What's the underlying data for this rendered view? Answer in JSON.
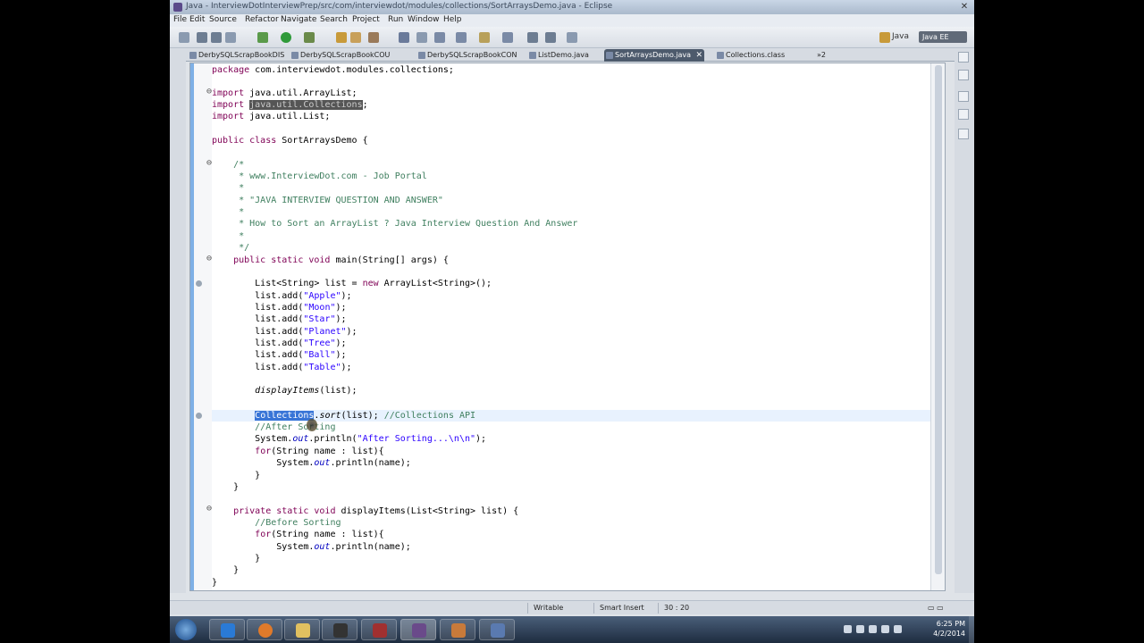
{
  "window": {
    "title": "Java - InterviewDotInterviewPrep/src/com/interviewdot/modules/collections/SortArraysDemo.java - Eclipse",
    "close_label": "✕"
  },
  "menu": [
    "File",
    "Edit",
    "Source",
    "Refactor",
    "Navigate",
    "Search",
    "Project",
    "Run",
    "Window",
    "Help"
  ],
  "perspective": {
    "java_label": "Java",
    "other_label": "Java EE"
  },
  "tabs": [
    {
      "label": "DerbySQLScrapBookDIS",
      "active": false
    },
    {
      "label": "DerbySQLScrapBookCOU",
      "active": false
    },
    {
      "label": "DerbySQLScrapBookCON",
      "active": false
    },
    {
      "label": "ListDemo.java",
      "active": false
    },
    {
      "label": "SortArraysDemo.java",
      "active": true
    },
    {
      "label": "Collections.class",
      "active": false
    },
    {
      "label": "»2",
      "active": false
    }
  ],
  "code": {
    "line01": "package com.interviewdot.modules.collections;",
    "import_kw": "import",
    "import1": " java.util.ArrayList;",
    "import2_pre": " ",
    "import2_hl": "java.util.Collections",
    "import2_post": ";",
    "import3": " java.util.List;",
    "class_kw": "public class",
    "class_name": " SortArraysDemo {",
    "c_open": "    /*",
    "c1": "     * www.InterviewDot.com - Job Portal",
    "c2": "     *",
    "c3": "     * \"JAVA INTERVIEW QUESTION AND ANSWER\"",
    "c4": "     *",
    "c5": "     * How to Sort an ArrayList ? Java Interview Question And Answer",
    "c6": "     *",
    "c_close": "     */",
    "main_kw": "    public static void",
    "main_rest": " main(String[] args) {",
    "list_decl_a": "        List<String> list = ",
    "list_decl_new": "new",
    "list_decl_b": " ArrayList<String>();",
    "add_prefix": "        list.add(",
    "add_suffix": ");",
    "items": [
      "\"Apple\"",
      "\"Moon\"",
      "\"Star\"",
      "\"Planet\"",
      "\"Tree\"",
      "\"Ball\"",
      "\"Table\""
    ],
    "display_pre": "        ",
    "display_call": "displayItems",
    "display_post": "(list);",
    "sort_pre": "        ",
    "sort_sel": "Collections",
    "sort_dot": ".",
    "sort_method": "sort",
    "sort_rest": "(list); ",
    "sort_comment": "//Collections API",
    "after_comment": "        //After Sorting",
    "println_a": "        System.",
    "println_out": "out",
    "println_b": ".println(",
    "println_str": "\"After Sorting...\\n\\n\"",
    "println_c": ");",
    "for_pre": "        ",
    "for_kw": "for",
    "for_rest": "(String name : list){",
    "inner_a": "            System.",
    "inner_b": ".println(name);",
    "close8": "        }",
    "close4": "    }",
    "priv_kw": "    private static void",
    "priv_rest": " displayItems(List<String> list) {",
    "before_comment": "        //Before Sorting",
    "close0": "}"
  },
  "status": {
    "writable": "Writable",
    "insert_mode": "Smart Insert",
    "position": "30 : 20"
  },
  "clock": {
    "time": "6:25 PM",
    "date": "4/2/2014"
  },
  "colors": {
    "keyword": "#7f0055",
    "string": "#2a00ff",
    "comment": "#3f7f5f",
    "selection": "#3875d7"
  }
}
